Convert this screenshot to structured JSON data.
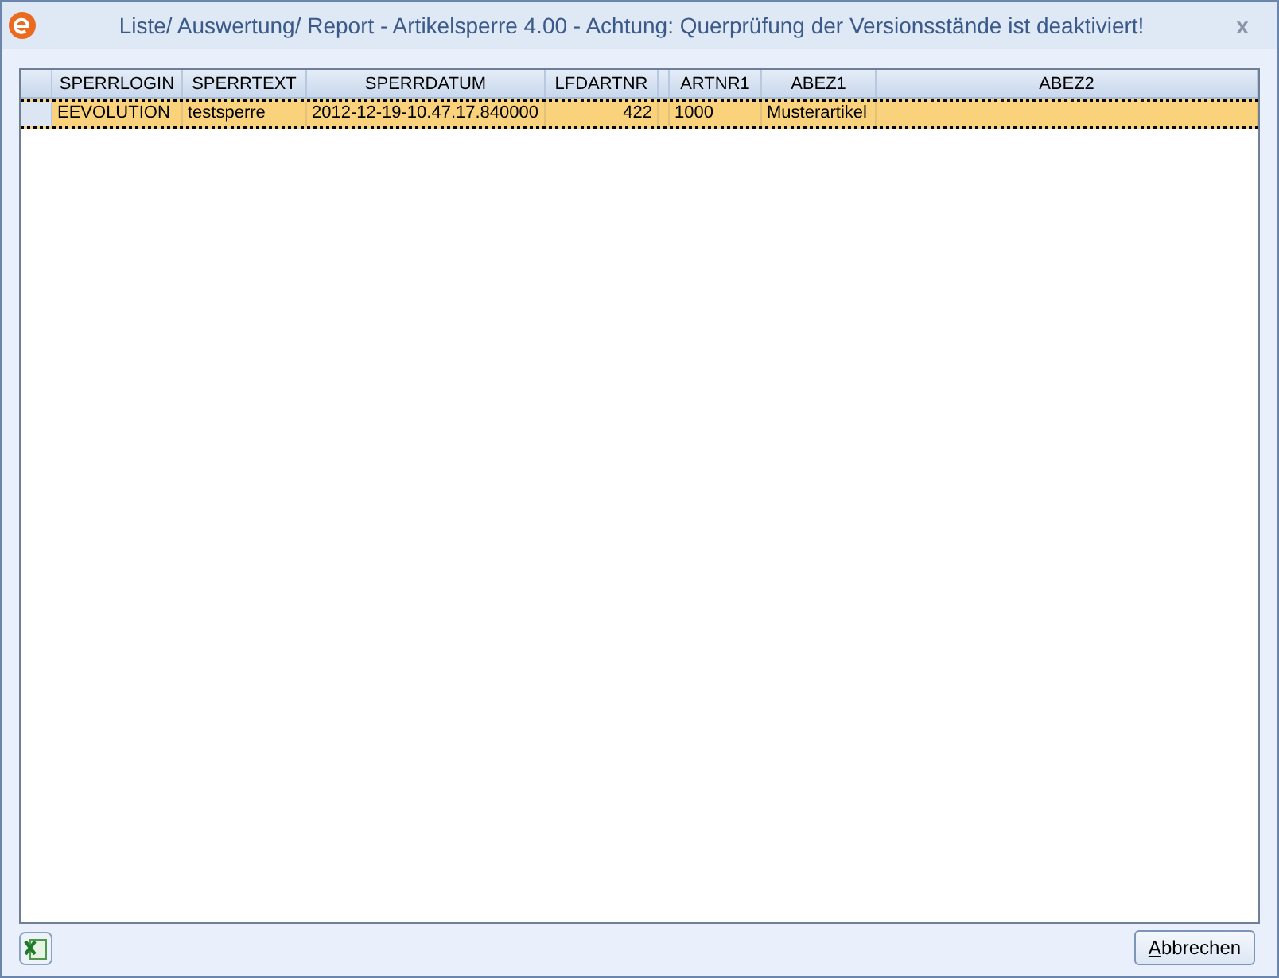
{
  "window": {
    "title": "Liste/ Auswertung/ Report - Artikelsperre 4.00 - Achtung: Querprüfung der Versionsstände ist deaktiviert!",
    "close": "x"
  },
  "table": {
    "columns": [
      {
        "label": "SPERRLOGIN"
      },
      {
        "label": "SPERRTEXT"
      },
      {
        "label": "SPERRDATUM"
      },
      {
        "label": "LFDARTNR"
      },
      {},
      {
        "label": "ARTNR1"
      },
      {
        "label": "ABEZ1"
      },
      {
        "label": "ABEZ2"
      }
    ],
    "rows": [
      {
        "selected": true,
        "cells": [
          "EEVOLUTION",
          "testsperre",
          "2012-12-19-10.47.17.840000",
          "422",
          null,
          "1000",
          "Musterartikel",
          null
        ]
      }
    ]
  },
  "buttons": [
    {
      "label": "Abbrechen"
    }
  ]
}
